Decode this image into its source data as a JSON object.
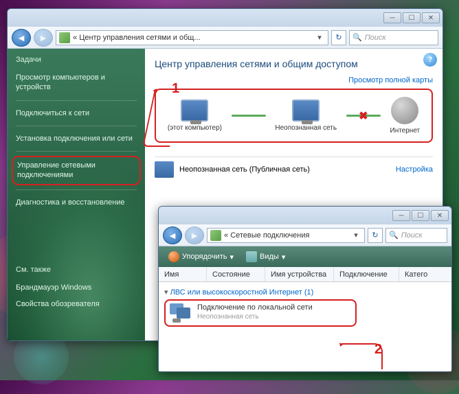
{
  "window1": {
    "address_prefix": "«",
    "address_text": "Центр управления сетями и общ...",
    "search_placeholder": "Поиск"
  },
  "sidebar": {
    "tasks_heading": "Задачи",
    "items": [
      "Просмотр компьютеров и устройств",
      "Подключиться к сети",
      "Установка подключения или сети",
      "Управление сетевыми подключениями",
      "Диагностика и восстановление"
    ],
    "see_also": "См. также",
    "bottom_items": [
      "Брандмауэр Windows",
      "Свойства обозревателя"
    ]
  },
  "main": {
    "title": "Центр управления сетями и общим доступом",
    "full_map": "Просмотр полной карты",
    "node_this": "(этот компьютер)",
    "node_unknown": "Неопознанная сеть",
    "node_internet": "Интернет",
    "network_status": "Неопознанная сеть (Публичная сеть)",
    "settings": "Настройка"
  },
  "annotations": {
    "one": "1",
    "two": "2"
  },
  "window2": {
    "address_prefix": "«",
    "address_text": "Сетевые подключения",
    "search_placeholder": "Поиск",
    "organize": "Упорядочить",
    "views": "Виды",
    "columns": [
      "Имя",
      "Состояние",
      "Имя устройства",
      "Подключение",
      "Катего"
    ],
    "category": "ЛВС или высокоскоростной Интернет (1)",
    "item_name": "Подключение по локальной сети",
    "item_status": "Неопознанная сеть"
  }
}
